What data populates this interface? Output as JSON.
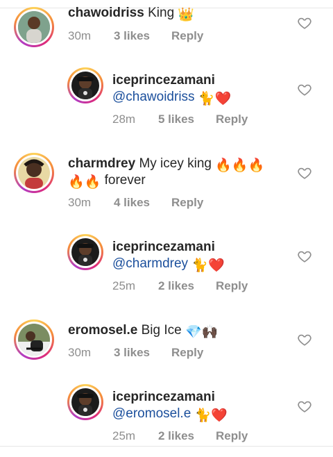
{
  "comments": [
    {
      "username": "chawoidriss",
      "text": "King",
      "emoji": "👑",
      "time": "30m",
      "likes": "3 likes",
      "reply": "Reply"
    },
    {
      "username": "iceprincezamani",
      "mention": "@chawoidriss",
      "emoji": "🐈❤️",
      "time": "28m",
      "likes": "5 likes",
      "reply": "Reply"
    },
    {
      "username": "charmdrey",
      "text": "My icey king",
      "emoji": "🔥🔥🔥",
      "text2_emoji": "🔥🔥",
      "text2": "forever",
      "time": "30m",
      "likes": "4 likes",
      "reply": "Reply"
    },
    {
      "username": "iceprincezamani",
      "mention": "@charmdrey",
      "emoji": "🐈❤️",
      "time": "25m",
      "likes": "2 likes",
      "reply": "Reply"
    },
    {
      "username": "eromosel.e",
      "text": "Big Ice",
      "emoji": "💎🙌🏿",
      "time": "30m",
      "likes": "3 likes",
      "reply": "Reply"
    },
    {
      "username": "iceprincezamani",
      "mention": "@eromosel.e",
      "emoji": "🐈❤️",
      "time": "25m",
      "likes": "2 likes",
      "reply": "Reply"
    }
  ],
  "colors": {
    "text": "#262626",
    "secondary": "#8e8e8e",
    "mention": "#1b4f9c"
  },
  "icons": {
    "like": "heart-outline-icon"
  }
}
